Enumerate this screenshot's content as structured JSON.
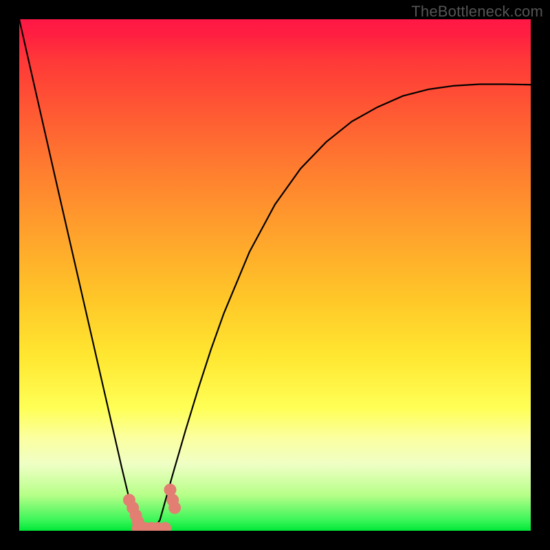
{
  "watermark": "TheBottleneck.com",
  "chart_data": {
    "type": "line",
    "title": "",
    "xlabel": "",
    "ylabel": "",
    "xlim": [
      0,
      1
    ],
    "ylim": [
      0,
      1
    ],
    "x": [
      0.0,
      0.025,
      0.05,
      0.075,
      0.1,
      0.125,
      0.15,
      0.175,
      0.2,
      0.225,
      0.24,
      0.25,
      0.26,
      0.275,
      0.3,
      0.325,
      0.35,
      0.375,
      0.4,
      0.45,
      0.5,
      0.55,
      0.6,
      0.65,
      0.7,
      0.75,
      0.8,
      0.85,
      0.9,
      0.95,
      1.0
    ],
    "values": [
      1.0,
      0.89,
      0.78,
      0.67,
      0.561,
      0.452,
      0.343,
      0.234,
      0.125,
      0.021,
      0.0,
      0.0,
      0.0,
      0.021,
      0.11,
      0.196,
      0.278,
      0.355,
      0.425,
      0.545,
      0.638,
      0.708,
      0.76,
      0.8,
      0.828,
      0.85,
      0.863,
      0.87,
      0.873,
      0.873,
      0.872
    ],
    "markers": [
      {
        "x": 0.215,
        "y": 0.06
      },
      {
        "x": 0.222,
        "y": 0.045
      },
      {
        "x": 0.228,
        "y": 0.03
      },
      {
        "x": 0.232,
        "y": 0.018
      },
      {
        "x": 0.295,
        "y": 0.08
      },
      {
        "x": 0.3,
        "y": 0.06
      },
      {
        "x": 0.304,
        "y": 0.045
      },
      {
        "x": 0.232,
        "y": 0.005
      },
      {
        "x": 0.245,
        "y": 0.005
      },
      {
        "x": 0.258,
        "y": 0.005
      },
      {
        "x": 0.27,
        "y": 0.005
      },
      {
        "x": 0.285,
        "y": 0.005
      }
    ],
    "gradient_stops": [
      {
        "pos": 0.0,
        "color": "#ff1846"
      },
      {
        "pos": 0.08,
        "color": "#ff3838"
      },
      {
        "pos": 0.3,
        "color": "#ff7f2f"
      },
      {
        "pos": 0.55,
        "color": "#ffc828"
      },
      {
        "pos": 0.76,
        "color": "#ffff56"
      },
      {
        "pos": 0.93,
        "color": "#b7ff88"
      },
      {
        "pos": 1.0,
        "color": "#00e838"
      }
    ],
    "marker_color": "#e37e72",
    "marker_radius_px": 9
  }
}
